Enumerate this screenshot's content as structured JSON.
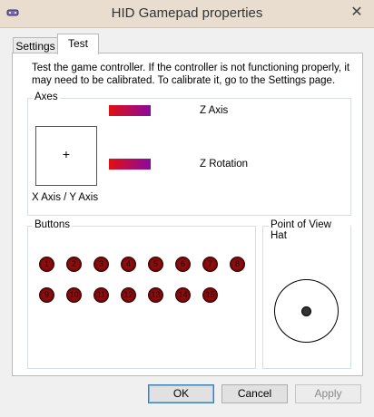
{
  "window": {
    "title": "HID Gamepad properties",
    "close_glyph": "✕"
  },
  "tabs": [
    {
      "label": "Settings",
      "active": false
    },
    {
      "label": "Test",
      "active": true
    }
  ],
  "instructions": "Test the game controller.  If the controller is not functioning properly, it may need to be calibrated.  To calibrate it, go to the Settings page.",
  "axes": {
    "group_label": "Axes",
    "xy_label": "X Axis / Y Axis",
    "crosshair": "+",
    "z_axis_label": "Z Axis",
    "z_rotation_label": "Z Rotation"
  },
  "buttons": {
    "group_label": "Buttons",
    "items": [
      "1",
      "2",
      "3",
      "4",
      "5",
      "6",
      "7",
      "8",
      "9",
      "10",
      "11",
      "12",
      "13",
      "14",
      "15"
    ]
  },
  "pov": {
    "group_label": "Point of View Hat"
  },
  "footer": {
    "ok_label": "OK",
    "cancel_label": "Cancel",
    "apply_label": "Apply"
  },
  "colors": {
    "button_fill": "#8b0f0f",
    "bar_start": "#e01010",
    "bar_end": "#8a0aa0"
  }
}
